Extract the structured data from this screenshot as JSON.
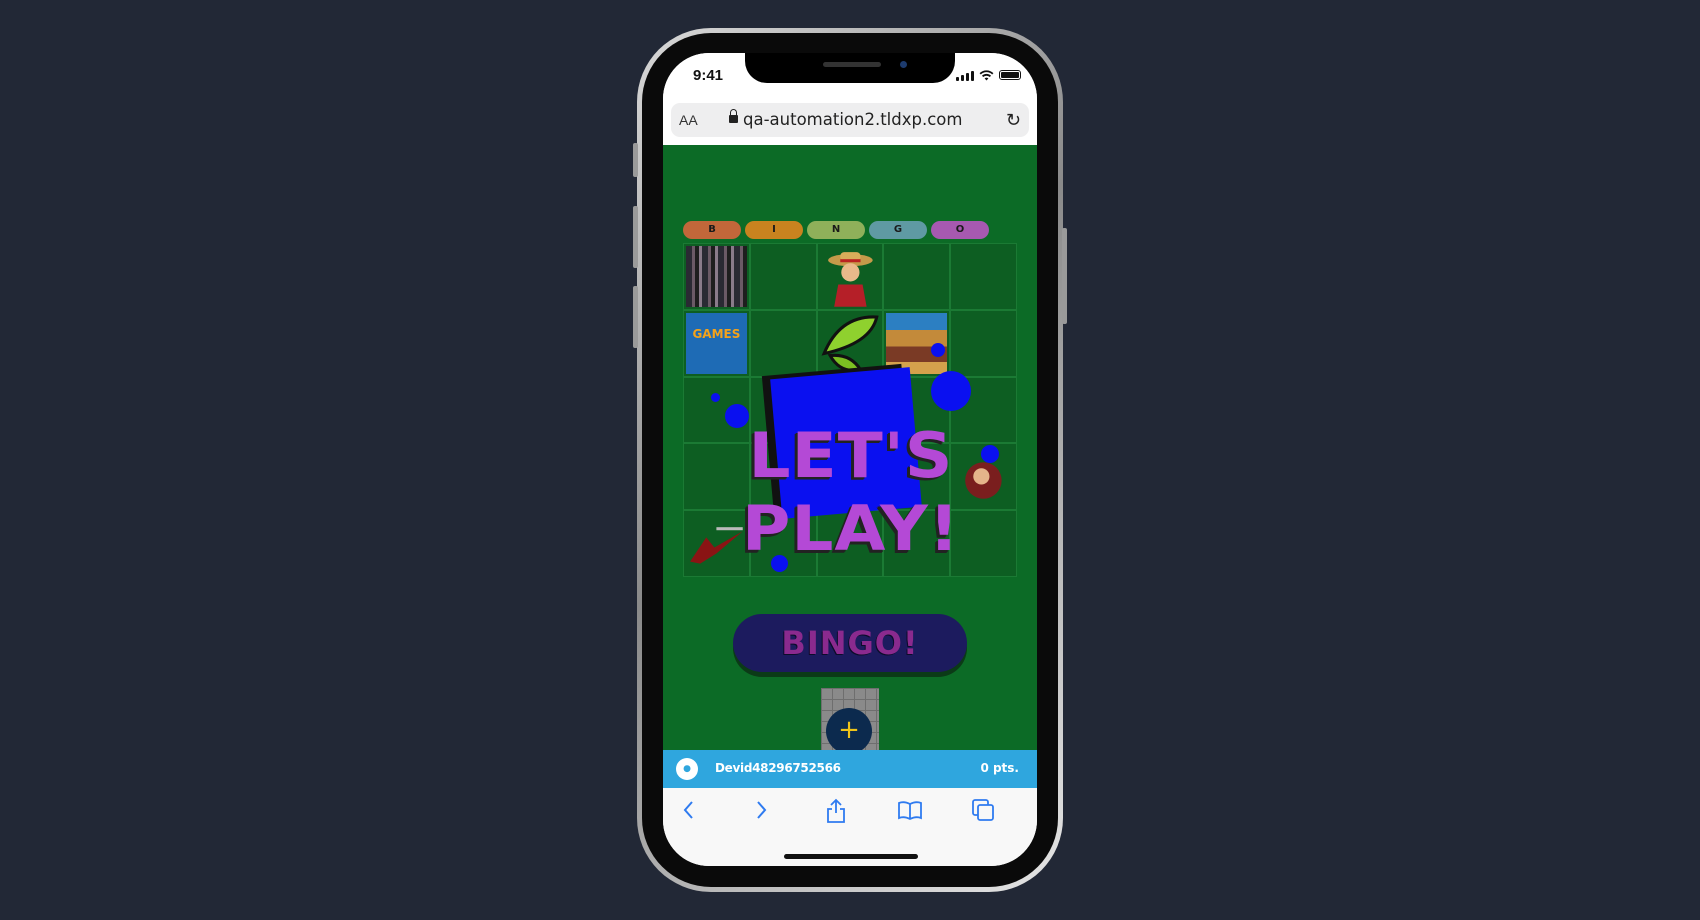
{
  "device": {
    "time": "9:41"
  },
  "browser": {
    "text_size_label": "AA",
    "url": "qa-automation2.tldxp.com",
    "reload_icon": "reload-icon"
  },
  "game": {
    "header_letters": [
      "B",
      "I",
      "N",
      "G",
      "O"
    ],
    "header_colors": [
      "#c2673a",
      "#c9831f",
      "#8fb05a",
      "#5f9aa3",
      "#a659b0"
    ],
    "banner_text": "LET'S PLAY!",
    "bingo_button_label": "BINGO!",
    "add_button_label": "+",
    "board_tiles": [
      [
        "collage",
        "",
        "character-straw-hat",
        "",
        ""
      ],
      [
        "games-logo",
        "",
        "butterfly",
        "crew-poster",
        ""
      ],
      [
        "",
        "",
        "",
        "",
        ""
      ],
      [
        "",
        "",
        "",
        "",
        "character-portrait"
      ],
      [
        "character-red",
        "",
        "",
        "",
        ""
      ]
    ]
  },
  "player": {
    "avatar_icon": "user-icon",
    "name": "Devid48296752566",
    "points": "0 pts."
  },
  "toolbar": {
    "back_icon": "back-icon",
    "forward_icon": "forward-icon",
    "share_icon": "share-icon",
    "bookmarks_icon": "bookmarks-icon",
    "tabs_icon": "tabs-icon"
  }
}
